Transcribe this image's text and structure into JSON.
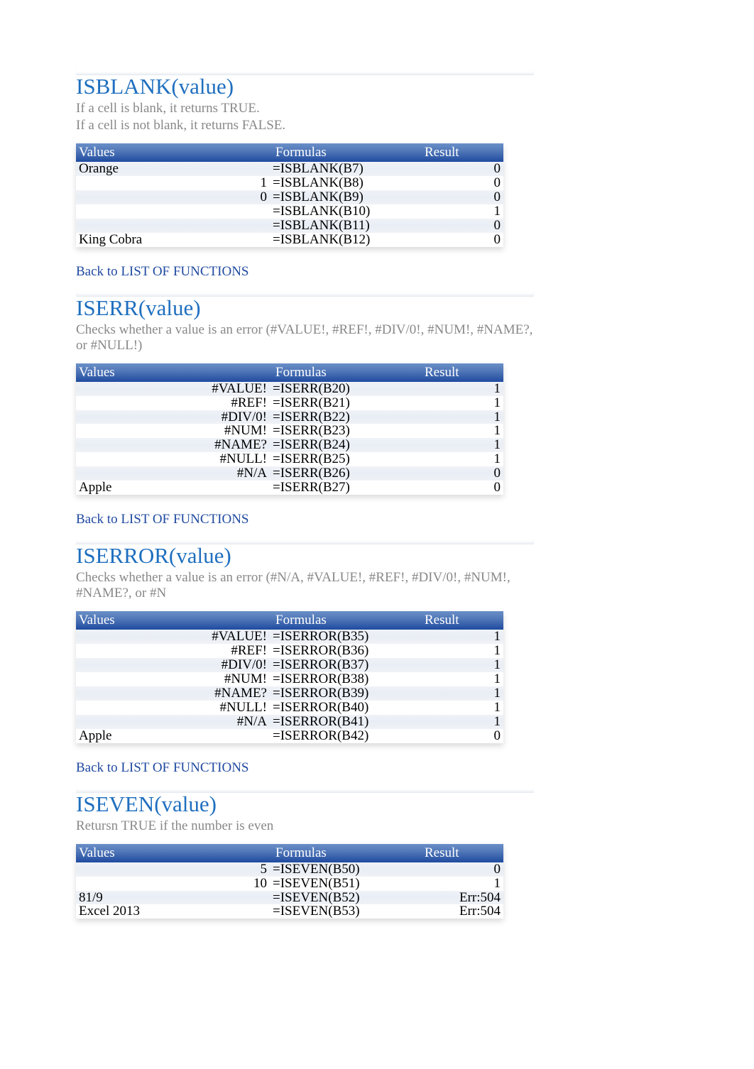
{
  "backlink_label": "Back to LIST OF FUNCTIONS",
  "headers": {
    "values": "Values",
    "formulas": "Formulas",
    "result": "Result"
  },
  "sections": [
    {
      "title": "ISBLANK(value)",
      "desc_lines": [
        "If a cell is blank, it returns TRUE.",
        "If a cell is not blank, it returns FALSE."
      ],
      "rows": [
        {
          "value": "Orange",
          "value_is_text": true,
          "formula": "=ISBLANK(B7)",
          "result": "0"
        },
        {
          "value": "1",
          "value_is_text": false,
          "formula": "=ISBLANK(B8)",
          "result": "0"
        },
        {
          "value": "0",
          "value_is_text": false,
          "formula": "=ISBLANK(B9)",
          "result": "0"
        },
        {
          "value": "",
          "value_is_text": false,
          "formula": "=ISBLANK(B10)",
          "result": "1"
        },
        {
          "value": "",
          "value_is_text": false,
          "formula": "=ISBLANK(B11)",
          "result": "0"
        },
        {
          "value": "King Cobra",
          "value_is_text": true,
          "formula": "=ISBLANK(B12)",
          "result": "0"
        }
      ]
    },
    {
      "title": "ISERR(value)",
      "desc_lines": [
        "Checks whether a value is an error (#VALUE!, #REF!, #DIV/0!, #NUM!, #NAME?, or #NULL!)"
      ],
      "rows": [
        {
          "value": "#VALUE!",
          "value_is_text": false,
          "formula": "=ISERR(B20)",
          "result": "1"
        },
        {
          "value": "#REF!",
          "value_is_text": false,
          "formula": "=ISERR(B21)",
          "result": "1"
        },
        {
          "value": "#DIV/0!",
          "value_is_text": false,
          "formula": "=ISERR(B22)",
          "result": "1"
        },
        {
          "value": "#NUM!",
          "value_is_text": false,
          "formula": "=ISERR(B23)",
          "result": "1"
        },
        {
          "value": "#NAME?",
          "value_is_text": false,
          "formula": "=ISERR(B24)",
          "result": "1"
        },
        {
          "value": "#NULL!",
          "value_is_text": false,
          "formula": "=ISERR(B25)",
          "result": "1"
        },
        {
          "value": "#N/A",
          "value_is_text": false,
          "formula": "=ISERR(B26)",
          "result": "0"
        },
        {
          "value": "Apple",
          "value_is_text": true,
          "formula": "=ISERR(B27)",
          "result": "0"
        }
      ]
    },
    {
      "title": "ISERROR(value)",
      "desc_lines": [
        "Checks whether a value is an error (#N/A, #VALUE!, #REF!, #DIV/0!, #NUM!, #NAME?, or #N"
      ],
      "rows": [
        {
          "value": "#VALUE!",
          "value_is_text": false,
          "formula": "=ISERROR(B35)",
          "result": "1"
        },
        {
          "value": "#REF!",
          "value_is_text": false,
          "formula": "=ISERROR(B36)",
          "result": "1"
        },
        {
          "value": "#DIV/0!",
          "value_is_text": false,
          "formula": "=ISERROR(B37)",
          "result": "1"
        },
        {
          "value": "#NUM!",
          "value_is_text": false,
          "formula": "=ISERROR(B38)",
          "result": "1"
        },
        {
          "value": "#NAME?",
          "value_is_text": false,
          "formula": "=ISERROR(B39)",
          "result": "1"
        },
        {
          "value": "#NULL!",
          "value_is_text": false,
          "formula": "=ISERROR(B40)",
          "result": "1"
        },
        {
          "value": "#N/A",
          "value_is_text": false,
          "formula": "=ISERROR(B41)",
          "result": "1"
        },
        {
          "value": "Apple",
          "value_is_text": true,
          "formula": "=ISERROR(B42)",
          "result": "0"
        }
      ]
    },
    {
      "title": "ISEVEN(value)",
      "desc_lines": [
        "Retursn TRUE if the number is even"
      ],
      "rows": [
        {
          "value": "5",
          "value_is_text": false,
          "formula": "=ISEVEN(B50)",
          "result": "0"
        },
        {
          "value": "10",
          "value_is_text": false,
          "formula": "=ISEVEN(B51)",
          "result": "1"
        },
        {
          "value": "81/9",
          "value_is_text": true,
          "formula": "=ISEVEN(B52)",
          "result": "Err:504"
        },
        {
          "value": "Excel 2013",
          "value_is_text": true,
          "formula": "=ISEVEN(B53)",
          "result": "Err:504"
        }
      ]
    }
  ]
}
